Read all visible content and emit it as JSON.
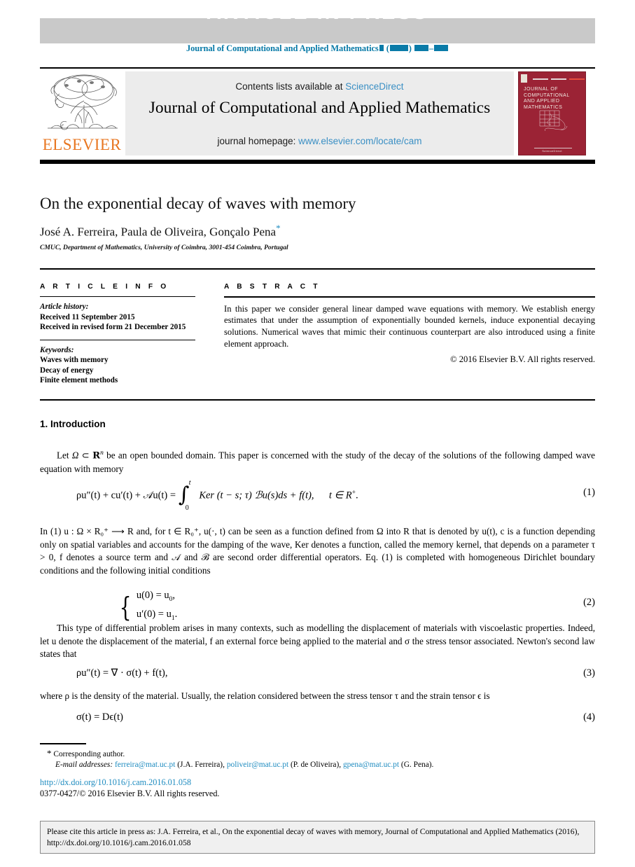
{
  "banner": {
    "text": "ARTICLE IN PRESS",
    "journal_ref_prefix": "Journal of Computational and Applied Mathematics",
    "journal_ref_open_paren": "(",
    "journal_ref_close_paren": ")",
    "journal_ref_dash": "–",
    "band_color": "#c9c9c9",
    "ref_color": "#0a7ba8"
  },
  "masthead": {
    "contents_label": "Contents lists available at",
    "sciencedirect": "ScienceDirect",
    "journal_name": "Journal of Computational and Applied Mathematics",
    "homepage_label": "journal homepage:",
    "homepage_url": "www.elsevier.com/locate/cam",
    "publisher": "ELSEVIER",
    "publisher_color": "#e87722",
    "link_color": "#3a8fc4",
    "cover": {
      "title": "JOURNAL OF COMPUTATIONAL AND APPLIED MATHEMATICS",
      "footer": "ScienceDirect",
      "color": "#9b2335"
    }
  },
  "article": {
    "title": "On the exponential decay of waves with memory",
    "authors": "José A. Ferreira, Paula de Oliveira, Gonçalo Pena",
    "corresponding_marker": "*",
    "affiliation": "CMUC, Department of Mathematics, University of Coimbra, 3001-454 Coimbra, Portugal"
  },
  "info": {
    "heading": "A R T I C L E  I N F O",
    "history_label": "Article history:",
    "history_lines": [
      "Received 11 September 2015",
      "Received in revised form 21 December 2015"
    ],
    "keywords_label": "Keywords:",
    "keywords": [
      "Waves with memory",
      "Decay of energy",
      "Finite element methods"
    ]
  },
  "abstract": {
    "heading": "A B S T R A C T",
    "text": "In this paper we consider general linear damped wave equations with memory. We establish energy estimates that under the assumption of exponentially bounded kernels, induce exponential decaying solutions. Numerical waves that mimic their continuous counterpart are also introduced using a finite element approach.",
    "copyright": "© 2016 Elsevier B.V. All rights reserved."
  },
  "body": {
    "section1_title": "1. Introduction",
    "para1_a": "Let ",
    "para1_omega": "Ω",
    "para1_b": " ⊂ ",
    "para1_rn": "R",
    "para1_rn_sup": "n",
    "para1_c": " be an open bounded domain. This paper is concerned with the study of the decay of the solutions of the following damped wave equation with memory",
    "eq1_number": "(1)",
    "eq2_number": "(2)",
    "eq3_number": "(3)",
    "eq4_number": "(4)",
    "eq1": {
      "lhs": "ρu″(t) + cu′(t) + 𝒜u(t) =",
      "int_upper": "t",
      "int_lower": "0",
      "rhs": "Ker (t − s; τ) ℬu(s)ds + f(t),",
      "tail": "t ∈ R",
      "tail_sup": "+",
      "tail_end": "."
    },
    "eq2": {
      "row1": "u(0) = u",
      "row1_sub": "0",
      "row1_end": ",",
      "row2": "u′(0) = u",
      "row2_sub": "1",
      "row2_end": "."
    },
    "eq3": {
      "text": "ρu″(t) = ∇ · σ(t) + f(t),"
    },
    "eq4": {
      "text": "σ(t) = Dϵ(t)"
    },
    "para2": "In (1) u : Ω × R₀⁺ ⟶ R and, for t ∈ R₀⁺, u(·, t) can be seen as a function defined from Ω into R that is denoted by u(t), c is a function depending only on spatial variables and accounts for the damping of the wave, Ker denotes a function, called the memory kernel, that depends on a parameter τ > 0, f denotes a source term and 𝒜 and ℬ are second order differential operators. Eq. (1) is completed with homogeneous Dirichlet boundary conditions and the following initial conditions",
    "para3": "This type of differential problem arises in many contexts, such as modelling the displacement of materials with viscoelastic properties. Indeed, let u denote the displacement of the material, f an external force being applied to the material and σ the stress tensor associated. Newton's second law states that",
    "para4": "where ρ is the density of the material. Usually, the relation considered between the stress tensor τ and the strain tensor ϵ is",
    "link_color": "#1f8cc0"
  },
  "footnotes": {
    "star": "*",
    "corresponding": "Corresponding author.",
    "email_label": "E-mail addresses:",
    "emails": [
      {
        "address": "ferreira@mat.uc.pt",
        "owner": "(J.A. Ferreira),"
      },
      {
        "address": "poliveir@mat.uc.pt",
        "owner": "(P. de Oliveira),"
      },
      {
        "address": "gpena@mat.uc.pt",
        "owner": "(G. Pena)."
      }
    ],
    "doi": "http://dx.doi.org/10.1016/j.cam.2016.01.058",
    "issn_line": "0377-0427/© 2016 Elsevier B.V. All rights reserved."
  },
  "citation_box": {
    "text": "Please cite this article in press as: J.A. Ferreira, et al., On the exponential decay of waves with memory, Journal of Computational and Applied Mathematics (2016), http://dx.doi.org/10.1016/j.cam.2016.01.058"
  }
}
